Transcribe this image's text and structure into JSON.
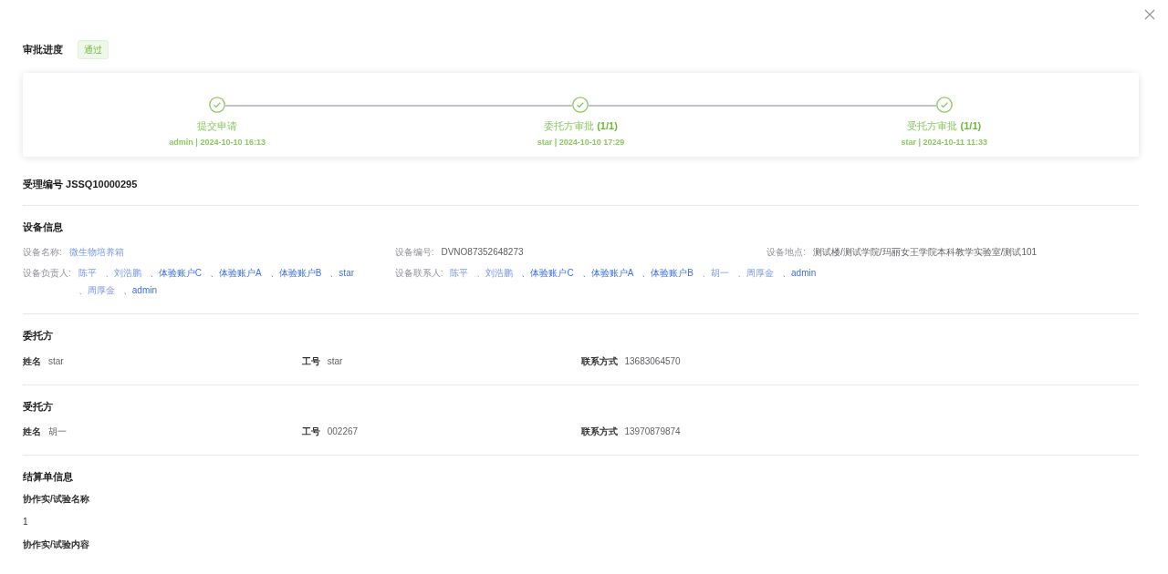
{
  "header": {
    "title": "审批进度",
    "status_badge": "通过"
  },
  "steps": [
    {
      "title": "提交申请",
      "meta": "admin | 2024-10-10 16:13",
      "finished": true
    },
    {
      "title": "委托方审批 **(1/1)**",
      "meta": "star | 2024-10-10 17:29",
      "finished": true
    },
    {
      "title": "受托方审批 **(1/1)**",
      "meta": "star | 2024-10-11 11:33",
      "finished": true
    }
  ],
  "acceptance_no": "受理编号 JSSQ10000295",
  "device": {
    "title": "设备信息",
    "name": {
      "label": "设备名称:",
      "value": "微生物培养箱"
    },
    "code": {
      "label": "设备编号:",
      "value": "DVNO87352648273"
    },
    "location": {
      "label": "设备地点:",
      "value": "测试楼/测试学院/玛丽女王学院本科教学实验室/测试101"
    },
    "owners": {
      "label": "设备负责人:",
      "people": [
        "陈平",
        "、刘浩鹏",
        "、体验账户C",
        "、体验账户A",
        "、体验账户B",
        "、star",
        "、周厚金",
        "、admin"
      ]
    },
    "contacts": {
      "label": "设备联系人:",
      "people": [
        "陈平",
        "、刘浩鹏",
        "、体验账户C",
        "、体验账户A",
        "、体验账户B",
        "、胡一",
        "、周厚金",
        "、admin"
      ]
    }
  },
  "parties": [
    {
      "title": "委托方",
      "fields": [
        {
          "label": "姓名",
          "value": "star"
        },
        {
          "label": "工号",
          "value": "star"
        },
        {
          "label": "联系方式",
          "value": "13683064570"
        }
      ]
    },
    {
      "title": "受托方",
      "fields": [
        {
          "label": "姓名",
          "value": "胡一"
        },
        {
          "label": "工号",
          "value": "002267"
        },
        {
          "label": "联系方式",
          "value": "13970879874"
        }
      ]
    }
  ],
  "settlement": {
    "title": "结算单信息",
    "items": [
      {
        "kind": "label",
        "text": "协作实/试验名称"
      },
      {
        "kind": "value",
        "text": "1"
      },
      {
        "kind": "label",
        "text": "协作实/试验内容"
      }
    ]
  }
}
